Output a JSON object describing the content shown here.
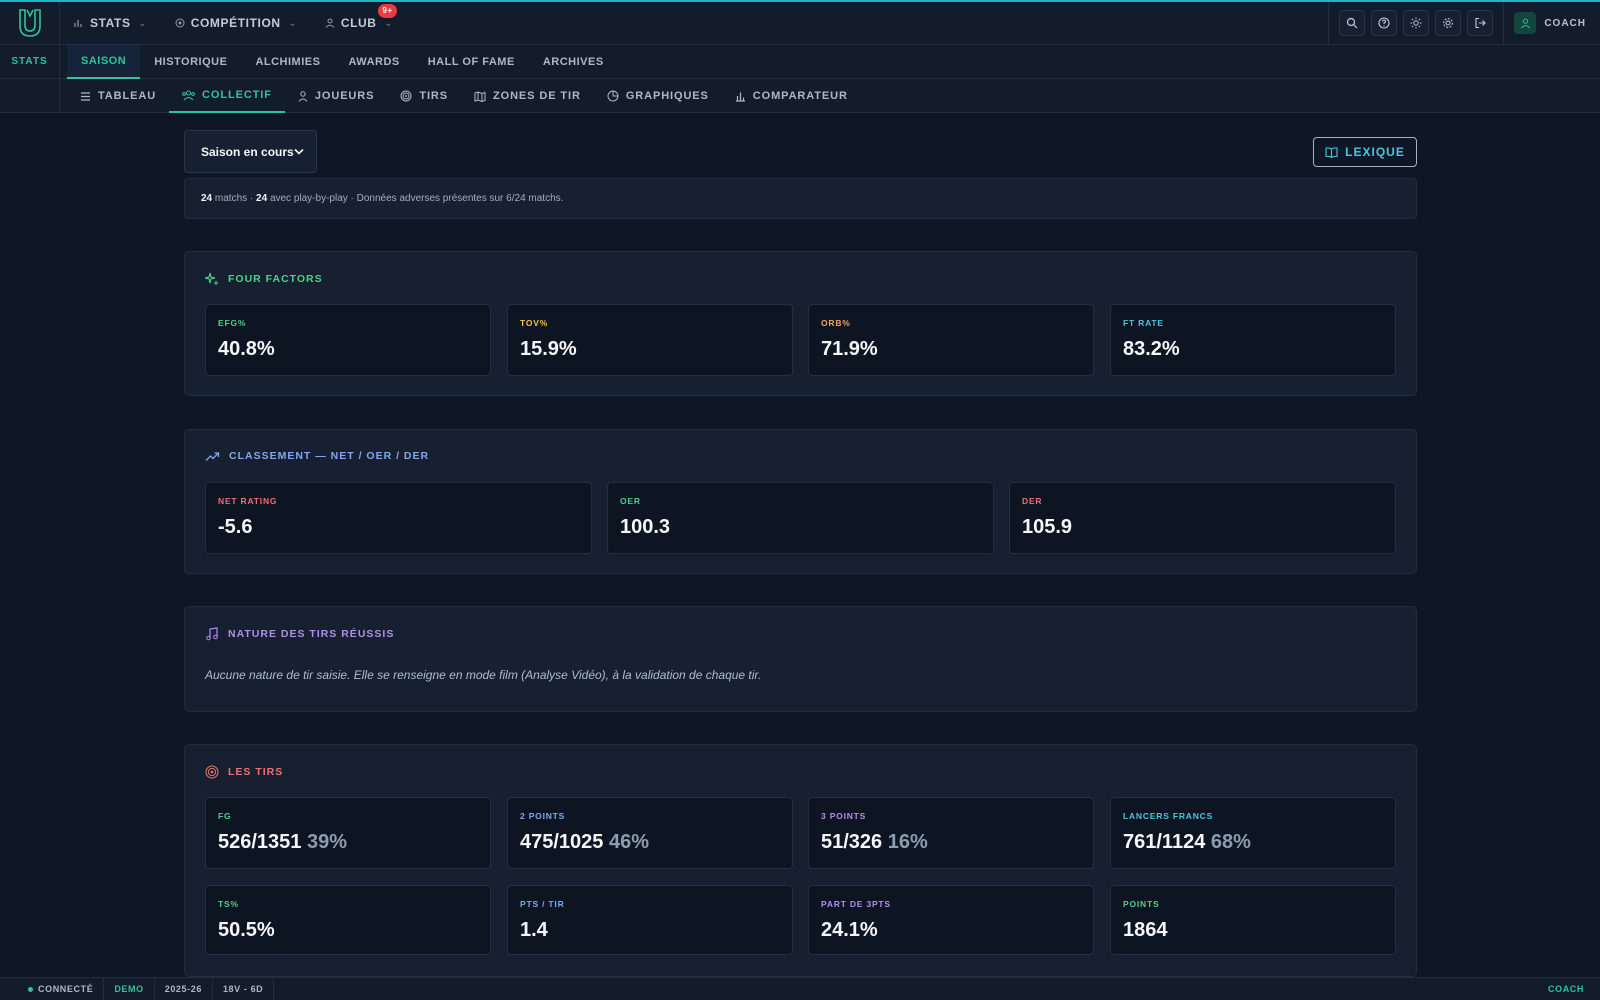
{
  "colors": {
    "accent": "#2fc49a",
    "cyan": "#48c6e0",
    "blue": "#7fa8ee",
    "purple": "#b18cf0",
    "red": "#f07070",
    "orange": "#f5a25c",
    "yellow": "#f2c54b",
    "green": "#4fd08a"
  },
  "topnav": {
    "stats": "STATS",
    "competition": "COMPÉTITION",
    "club": "CLUB",
    "club_badge": "9+",
    "user_label": "COACH"
  },
  "tabs": {
    "side_label": "STATS",
    "items": [
      {
        "label": "SAISON"
      },
      {
        "label": "HISTORIQUE"
      },
      {
        "label": "ALCHIMIES"
      },
      {
        "label": "AWARDS"
      },
      {
        "label": "HALL OF FAME"
      },
      {
        "label": "ARCHIVES"
      }
    ]
  },
  "subtabs": {
    "items": [
      {
        "label": "TABLEAU",
        "icon": "list-icon"
      },
      {
        "label": "COLLECTIF",
        "icon": "team-icon"
      },
      {
        "label": "JOUEURS",
        "icon": "user-icon"
      },
      {
        "label": "TIRS",
        "icon": "target-icon"
      },
      {
        "label": "ZONES DE TIR",
        "icon": "map-icon"
      },
      {
        "label": "GRAPHIQUES",
        "icon": "pie-icon"
      },
      {
        "label": "COMPARATEUR",
        "icon": "bar-chart-icon"
      }
    ]
  },
  "toolbar": {
    "season": "Saison en cours",
    "lexique": "LEXIQUE"
  },
  "info": {
    "matches": "24",
    "matches_label": "matchs ·",
    "pbp": "24",
    "pbp_label": "avec play-by-play · Données adverses présentes sur 6/24 matchs."
  },
  "four_factors": {
    "title": "FOUR FACTORS",
    "cards": [
      {
        "label": "EFG%",
        "value": "40.8%"
      },
      {
        "label": "TOV%",
        "value": "15.9%"
      },
      {
        "label": "ORB%",
        "value": "71.9%"
      },
      {
        "label": "FT RATE",
        "value": "83.2%"
      }
    ]
  },
  "ratings": {
    "title": "CLASSEMENT — NET / OER / DER",
    "cards": [
      {
        "label": "NET RATING",
        "value": "-5.6"
      },
      {
        "label": "OER",
        "value": "100.3"
      },
      {
        "label": "DER",
        "value": "105.9"
      }
    ]
  },
  "nature": {
    "title": "NATURE DES TIRS RÉUSSIS",
    "text": "Aucune nature de tir saisie. Elle se renseigne en mode film (Analyse Vidéo), à la validation de chaque tir."
  },
  "shots": {
    "title": "LES TIRS",
    "cards": [
      {
        "label": "FG",
        "value": "526/1351",
        "pct": "39%"
      },
      {
        "label": "2 POINTS",
        "value": "475/1025",
        "pct": "46%"
      },
      {
        "label": "3 POINTS",
        "value": "51/326",
        "pct": "16%"
      },
      {
        "label": "LANCERS FRANCS",
        "value": "761/1124",
        "pct": "68%"
      },
      {
        "label": "TS%",
        "value": "50.5%"
      },
      {
        "label": "PTS / TIR",
        "value": "1.4"
      },
      {
        "label": "PART DE 3PTS",
        "value": "24.1%"
      },
      {
        "label": "POINTS",
        "value": "1864"
      }
    ]
  },
  "status": {
    "connected": "CONNECTÉ",
    "demo": "DEMO",
    "season": "2025-26",
    "record": "18V - 6D",
    "role": "COACH"
  }
}
